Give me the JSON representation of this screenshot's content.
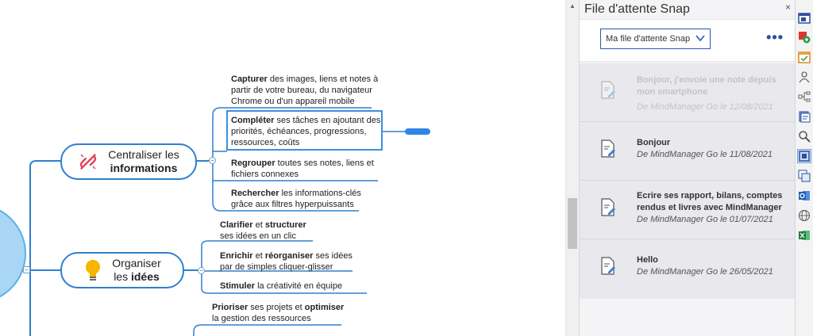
{
  "mindmap": {
    "topics": [
      {
        "id": "informations",
        "line1": "Centraliser les",
        "line2": "informations"
      },
      {
        "id": "idees",
        "line1": "Organiser",
        "line2a": "les ",
        "line2b": "idées"
      }
    ],
    "subtopics": {
      "capturer": {
        "bold": "Capturer",
        "rest": " des images, liens et notes à",
        "l2": "partir de votre bureau, du navigateur",
        "l3": "Chrome ou d'un appareil mobile"
      },
      "completer": {
        "bold": "Compléter",
        "rest": " ses tâches en ajoutant des",
        "l2": "priorités, échéances, progressions,",
        "l3": "ressources, coûts"
      },
      "regrouper": {
        "bold": "Regrouper",
        "rest": " toutes ses notes, liens et",
        "l2": "fichiers connexes"
      },
      "rechercher": {
        "bold": "Rechercher",
        "rest": " les informations-clés",
        "l2": "grâce aux filtres hyperpuissants"
      },
      "clarifier": {
        "bold1": "Clarifier",
        "mid": " et ",
        "bold2": "structurer",
        "l2": "ses idées en un clic"
      },
      "enrichir": {
        "bold1": "Enrichir",
        "mid": " et ",
        "bold2": "réorganiser",
        "rest": " ses idées",
        "l2": "par de simples cliquer-glisser"
      },
      "stimuler": {
        "bold": "Stimuler",
        "rest": " la créativité en équipe"
      },
      "prioriser": {
        "bold1": "Prioriser",
        "mid": " ses projets et ",
        "bold2": "optimiser",
        "l2": "la gestion des ressources"
      }
    }
  },
  "panel": {
    "title": "File d'attente Snap",
    "close_label": "×",
    "queue_selector": "Ma file d'attente Snap",
    "more_label": "•••",
    "items": [
      {
        "title": "Bonjour, j'envoie une note depuis mon smartphone",
        "meta": "De MindManager Go le 12/08/2021",
        "faded": true
      },
      {
        "title": "Bonjour",
        "meta": "De MindManager Go le 11/08/2021",
        "faded": false
      },
      {
        "title": "Ecrire ses rapport, bilans, comptes rendus et livres avec MindManager",
        "meta": "De MindManager Go le 01/07/2021",
        "faded": false
      },
      {
        "title": "Hello",
        "meta": "De MindManager Go le 26/05/2021",
        "faded": false
      }
    ]
  },
  "sidebar_icons": [
    "window-icon",
    "gift-icon",
    "calendar-icon",
    "person-icon",
    "tree-icon",
    "library-icon",
    "search-icon",
    "frame-icon",
    "pages-icon",
    "outlook-icon",
    "globe-icon",
    "excel-icon"
  ],
  "colors": {
    "accent": "#2f7fd0",
    "panel_bg": "#f4f4f6",
    "list_bg": "#e8e8ed",
    "link_blue": "#2c4f9e"
  }
}
